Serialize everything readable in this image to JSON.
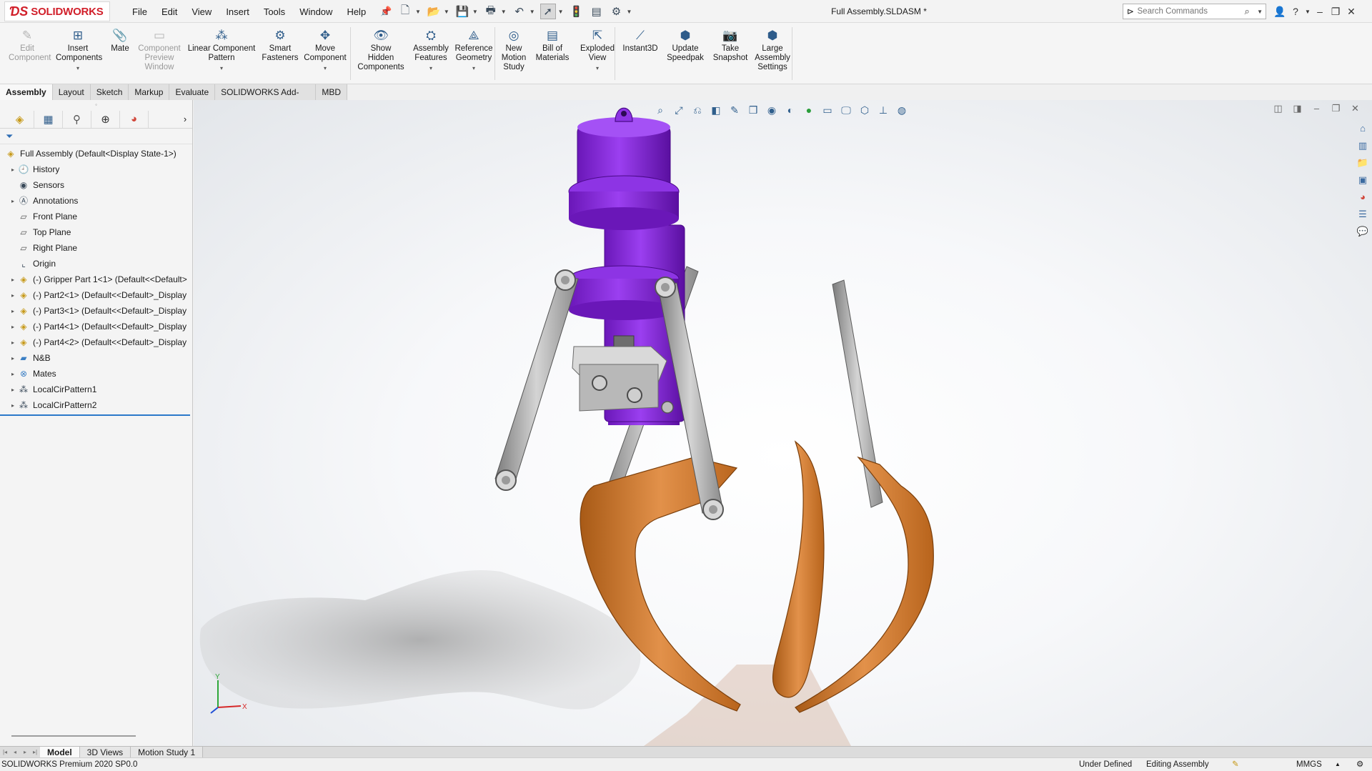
{
  "app": {
    "logo_text": "SOLIDWORKS",
    "document_title": "Full Assembly.SLDASM *"
  },
  "menu": [
    "File",
    "Edit",
    "View",
    "Insert",
    "Tools",
    "Window",
    "Help"
  ],
  "search": {
    "placeholder": "Search Commands"
  },
  "commands": [
    {
      "id": "edit-component",
      "label1": "Edit",
      "label2": "Component",
      "label3": "",
      "label4": "",
      "icon": "edit-component-icon",
      "disabled": true,
      "dropdown": false
    },
    {
      "id": "insert-components",
      "label1": "Insert",
      "label2": "Components",
      "label3": "",
      "label4": "",
      "icon": "insert-components-icon",
      "disabled": false,
      "dropdown": true
    },
    {
      "id": "mate",
      "label1": "Mate",
      "label2": "",
      "label3": "",
      "label4": "",
      "icon": "paperclip-icon",
      "disabled": false,
      "dropdown": false
    },
    {
      "id": "component-preview-window",
      "label1": "Component",
      "label2": "Preview",
      "label3": "Window",
      "label4": "",
      "icon": "preview-window-icon",
      "disabled": true,
      "dropdown": false
    },
    {
      "id": "linear-component-pattern",
      "label1": "Linear Component",
      "label2": "Pattern",
      "label3": "",
      "label4": "",
      "icon": "linear-pattern-icon",
      "disabled": false,
      "dropdown": true
    },
    {
      "id": "smart-fasteners",
      "label1": "Smart",
      "label2": "Fasteners",
      "label3": "",
      "label4": "",
      "icon": "smart-fasteners-icon",
      "disabled": false,
      "dropdown": false
    },
    {
      "id": "move-component",
      "label1": "Move",
      "label2": "Component",
      "label3": "",
      "label4": "",
      "icon": "move-component-icon",
      "disabled": false,
      "dropdown": true
    },
    {
      "id": "show-hidden-components",
      "label1": "Show",
      "label2": "Hidden",
      "label3": "Components",
      "label4": "",
      "icon": "show-hidden-icon",
      "disabled": false,
      "dropdown": false
    },
    {
      "id": "assembly-features",
      "label1": "Assembly",
      "label2": "Features",
      "label3": "",
      "label4": "",
      "icon": "assembly-features-icon",
      "disabled": false,
      "dropdown": true
    },
    {
      "id": "reference-geometry",
      "label1": "Reference",
      "label2": "Geometry",
      "label3": "",
      "label4": "",
      "icon": "reference-geometry-icon",
      "disabled": false,
      "dropdown": true
    },
    {
      "id": "new-motion-study",
      "label1": "New",
      "label2": "Motion",
      "label3": "Study",
      "label4": "",
      "icon": "motion-study-icon",
      "disabled": false,
      "dropdown": false
    },
    {
      "id": "bill-of-materials",
      "label1": "Bill of",
      "label2": "Materials",
      "label3": "",
      "label4": "",
      "icon": "bill-of-materials-icon",
      "disabled": false,
      "dropdown": false
    },
    {
      "id": "exploded-view",
      "label1": "Exploded",
      "label2": "View",
      "label3": "",
      "label4": "",
      "icon": "exploded-view-icon",
      "disabled": false,
      "dropdown": true
    },
    {
      "id": "instant3d",
      "label1": "Instant3D",
      "label2": "",
      "label3": "",
      "label4": "",
      "icon": "instant3d-icon",
      "disabled": false,
      "dropdown": false
    },
    {
      "id": "update-speedpak",
      "label1": "Update",
      "label2": "Speedpak",
      "label3": "",
      "label4": "",
      "icon": "speedpak-icon",
      "disabled": false,
      "dropdown": false
    },
    {
      "id": "take-snapshot",
      "label1": "Take",
      "label2": "Snapshot",
      "label3": "",
      "label4": "",
      "icon": "camera-icon",
      "disabled": false,
      "dropdown": false
    },
    {
      "id": "large-assembly-settings",
      "label1": "Large",
      "label2": "Assembly",
      "label3": "Settings",
      "label4": "",
      "icon": "large-assembly-icon",
      "disabled": false,
      "dropdown": false
    }
  ],
  "tabs": [
    "Assembly",
    "Layout",
    "Sketch",
    "Markup",
    "Evaluate",
    "SOLIDWORKS Add-Ins",
    "MBD"
  ],
  "active_tab": "Assembly",
  "tree": {
    "root": "Full Assembly  (Default<Display State-1>)",
    "items": [
      {
        "label": "History",
        "expandable": true,
        "icon": "history-icon"
      },
      {
        "label": "Sensors",
        "expandable": false,
        "icon": "sensors-icon"
      },
      {
        "label": "Annotations",
        "expandable": true,
        "icon": "annotations-icon"
      },
      {
        "label": "Front Plane",
        "expandable": false,
        "icon": "plane-icon"
      },
      {
        "label": "Top Plane",
        "expandable": false,
        "icon": "plane-icon"
      },
      {
        "label": "Right Plane",
        "expandable": false,
        "icon": "plane-icon"
      },
      {
        "label": "Origin",
        "expandable": false,
        "icon": "origin-icon"
      },
      {
        "label": "(-) Gripper Part 1<1> (Default<<Default>",
        "expandable": true,
        "icon": "part-icon"
      },
      {
        "label": "(-) Part2<1> (Default<<Default>_Display",
        "expandable": true,
        "icon": "part-icon"
      },
      {
        "label": "(-) Part3<1> (Default<<Default>_Display",
        "expandable": true,
        "icon": "part-icon"
      },
      {
        "label": "(-) Part4<1> (Default<<Default>_Display",
        "expandable": true,
        "icon": "part-icon"
      },
      {
        "label": "(-) Part4<2> (Default<<Default>_Display",
        "expandable": true,
        "icon": "part-icon"
      },
      {
        "label": "N&B",
        "expandable": true,
        "icon": "folder-icon"
      },
      {
        "label": "Mates",
        "expandable": true,
        "icon": "mates-icon"
      },
      {
        "label": "LocalCirPattern1",
        "expandable": true,
        "icon": "circular-pattern-icon"
      },
      {
        "label": "LocalCirPattern2",
        "expandable": true,
        "icon": "circular-pattern-icon"
      }
    ]
  },
  "triad": {
    "x": "X",
    "y": "Y"
  },
  "bottom_tabs": [
    "Model",
    "3D Views",
    "Motion Study 1"
  ],
  "active_bottom_tab": "Model",
  "status": {
    "product": "SOLIDWORKS Premium 2020 SP0.0",
    "definition": "Under Defined",
    "mode": "Editing Assembly",
    "units": "MMGS"
  },
  "colors": {
    "brand_red": "#d11f2a",
    "motor_purple": "#8a2be2",
    "finger_orange": "#d9822b",
    "link_gray": "#a8a8a8",
    "tree_selection": "#2b79c9"
  }
}
